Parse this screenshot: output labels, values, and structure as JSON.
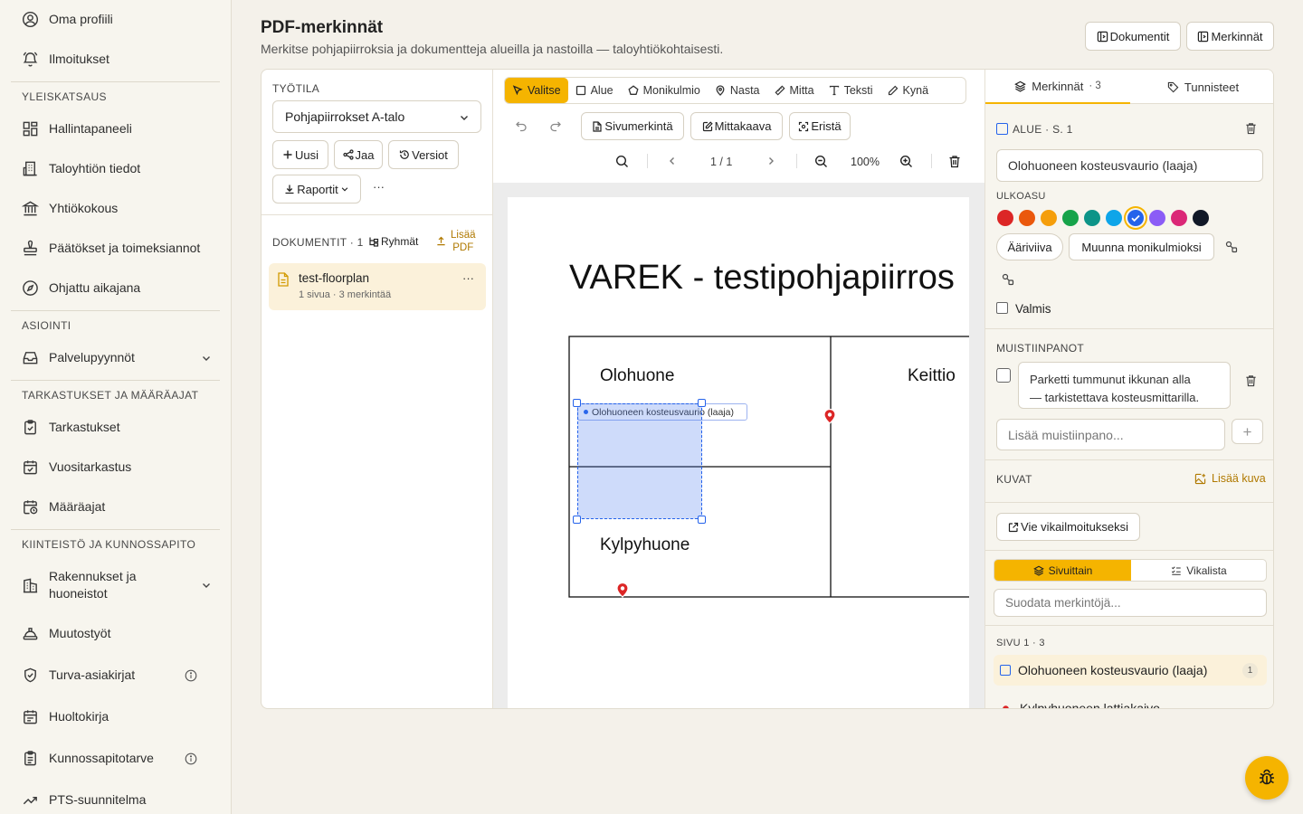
{
  "sidebar": {
    "items": [
      {
        "label": "Oma profiili",
        "icon": "user-circle-icon"
      },
      {
        "label": "Ilmoitukset",
        "icon": "bell-icon"
      },
      {
        "label": "Hallintapaneeli",
        "icon": "dashboard-icon"
      },
      {
        "label": "Taloyhtiön tiedot",
        "icon": "building-icon"
      },
      {
        "label": "Yhtiökokous",
        "icon": "landmark-icon"
      },
      {
        "label": "Päätökset ja toimeksiannot",
        "icon": "stamp-icon"
      },
      {
        "label": "Ohjattu aikajana",
        "icon": "compass-icon"
      },
      {
        "label": "Palvelupyynnöt",
        "icon": "inbox-icon"
      },
      {
        "label": "Tarkastukset",
        "icon": "clipboard-check-icon"
      },
      {
        "label": "Vuositarkastus",
        "icon": "calendar-check-icon"
      },
      {
        "label": "Määräajat",
        "icon": "calendar-clock-icon"
      },
      {
        "label": "Rakennukset ja huoneistot",
        "icon": "buildings-icon"
      },
      {
        "label": "Muutostyöt",
        "icon": "hard-hat-icon"
      },
      {
        "label": "Turva-asiakirjat",
        "icon": "shield-icon"
      },
      {
        "label": "Huoltokirja",
        "icon": "book-icon"
      },
      {
        "label": "Kunnossapitotarve",
        "icon": "clipboard-list-icon"
      },
      {
        "label": "PTS-suunnitelma",
        "icon": "trend-icon"
      }
    ],
    "sections": [
      "YLEISKATSAUS",
      "ASIOINTI",
      "TARKASTUKSET JA MÄÄRÄAJAT",
      "KIINTEISTÖ JA KUNNOSSAPITO"
    ]
  },
  "header": {
    "title": "PDF-merkinnät",
    "subtitle": "Merkitse pohjapiirroksia ja dokumentteja alueilla ja nastoilla — taloyhtiökohtaisesti.",
    "btn_document": "Dokumentit",
    "btn_markings": "Merkinnät"
  },
  "workspace": {
    "label": "TYÖTILA",
    "selected": "Pohjapiirrokset A-talo",
    "btn_new": "Uusi",
    "btn_share": "Jaa",
    "btn_versions": "Versiot",
    "btn_reports": "Raportit",
    "more": "···"
  },
  "documents": {
    "label": "DOKUMENTIT · 1",
    "btn_groups": "Ryhmät",
    "btn_add_line1": "Lisää",
    "btn_add_line2": "PDF",
    "item_name": "test-floorplan",
    "item_meta": "1 sivua · 3 merkintää",
    "more": "···"
  },
  "toolbar": {
    "tools": [
      "Valitse",
      "Alue",
      "Monikulmio",
      "Nasta",
      "Mitta",
      "Teksti",
      "Kynä"
    ],
    "btn_page_mark": "Sivumerkintä",
    "btn_scale": "Mittakaava",
    "btn_isolate": "Eristä",
    "page": "1 / 1",
    "zoom": "100%"
  },
  "pdf": {
    "title": "VAREK - testipohjapiirros",
    "room1": "Olohuone",
    "room2": "Keittio",
    "room3": "Kylpyhuone",
    "area_label": "Olohuoneen kosteusvaurio (laaja)"
  },
  "panel": {
    "tab_markings": "Merkinnät",
    "tab_markings_count": "· 3",
    "tab_tags": "Tunnisteet",
    "type_label": "ALUE · S. 1",
    "name_value": "Olohuoneen kosteusvaurio (laaja)",
    "appearance_label": "ULKOASU",
    "colors": [
      "#dc2626",
      "#ea580c",
      "#f59e0b",
      "#16a34a",
      "#0d9488",
      "#0ea5e9",
      "#2563eb",
      "#8b5cf6",
      "#db2777",
      "#111827"
    ],
    "btn_outline": "Ääriviiva",
    "btn_polygon": "Muunna monikulmioksi",
    "done_label": "Valmis",
    "notes_label": "MUISTIINPANOT",
    "note_line1": "Parketti tummunut ikkunan alla",
    "note_line2": "— tarkistettava kosteusmittarilla.",
    "note_placeholder": "Lisää muistiinpano...",
    "images_label": "KUVAT",
    "btn_add_image": "Lisää kuva",
    "btn_export": "Vie vikailmoitukseksi",
    "seg_pages": "Sivuittain",
    "seg_list": "Vikalista",
    "filter_placeholder": "Suodata merkintöjä...",
    "page_group": "SIVU 1 · 3",
    "list_item1": "Olohuoneen kosteusvaurio (laaja)",
    "list_item1_count": "1",
    "list_item2": "Kylpyhuoneen lattiakaivo"
  },
  "accent": "#f5b400"
}
